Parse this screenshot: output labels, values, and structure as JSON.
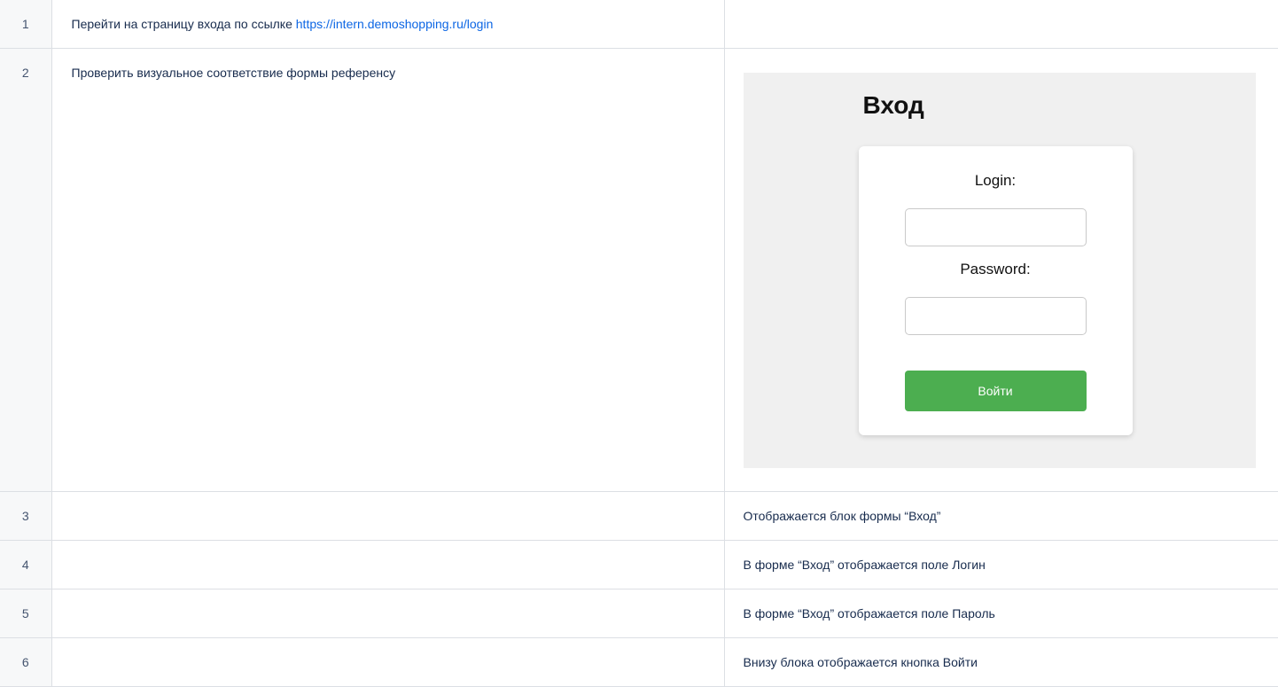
{
  "rows": [
    {
      "num": "1",
      "step": "Перейти на страницу входа по ссылке",
      "link": "https://intern.demoshopping.ru/login",
      "result": ""
    },
    {
      "num": "2",
      "step": "Проверить визуальное соответствие формы референсу",
      "result": ""
    },
    {
      "num": "3",
      "step": "",
      "result": "Отображается блок формы “Вход”"
    },
    {
      "num": "4",
      "step": "",
      "result": "В форме “Вход” отображается поле Логин"
    },
    {
      "num": "5",
      "step": "",
      "result": "В форме “Вход” отображается поле Пароль"
    },
    {
      "num": "6",
      "step": "",
      "result": "Внизу блока отображается кнопка Войти"
    }
  ],
  "reference": {
    "title": "Вход",
    "login_label": "Login:",
    "password_label": "Password:",
    "submit_label": "Войти",
    "background_color": "#f0f0f0",
    "button_color": "#4cae50"
  }
}
